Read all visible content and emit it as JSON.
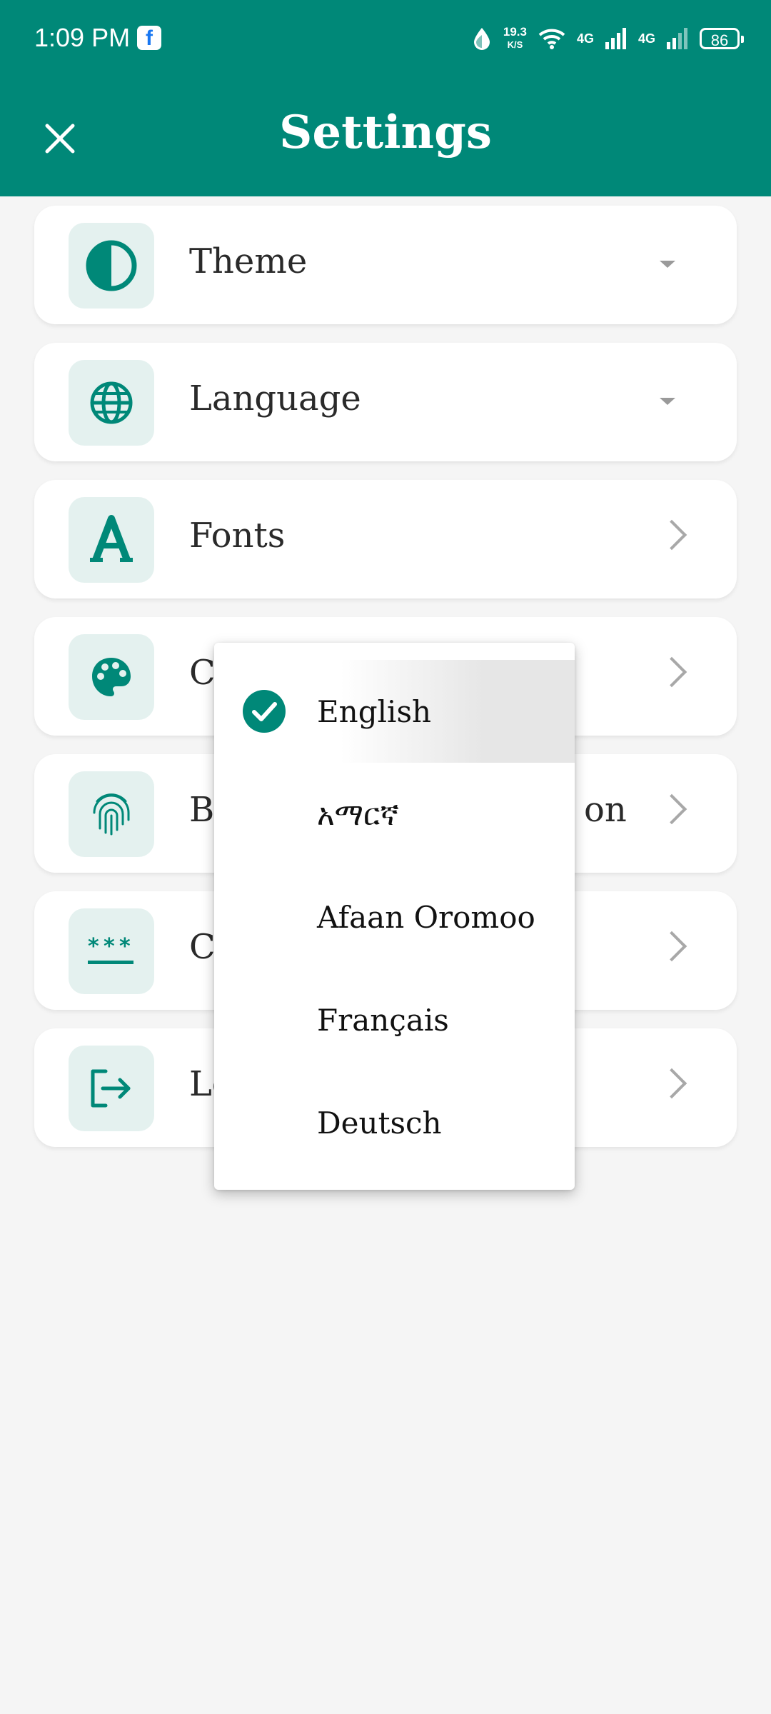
{
  "status_bar": {
    "time": "1:09 PM",
    "speed_value": "19.3",
    "speed_unit": "K/S",
    "network1": "4G",
    "network2": "4G",
    "battery": "86"
  },
  "header": {
    "title": "Settings",
    "close_icon": "close-icon"
  },
  "settings": [
    {
      "label": "Theme",
      "icon": "theme-icon",
      "trailing": "dropdown"
    },
    {
      "label": "Language",
      "icon": "globe-icon",
      "trailing": "dropdown"
    },
    {
      "label": "Fonts",
      "icon": "font-icon",
      "trailing": "chevron"
    },
    {
      "label": "Co",
      "icon": "palette-icon",
      "trailing": "chevron"
    },
    {
      "label": "Bi",
      "label_tail": "on",
      "icon": "fingerprint-icon",
      "trailing": "chevron"
    },
    {
      "label": "Cl",
      "icon": "password-icon",
      "trailing": "chevron"
    },
    {
      "label": "Lo",
      "icon": "logout-icon",
      "trailing": "chevron"
    }
  ],
  "language_menu": {
    "selected": "English",
    "options": [
      "English",
      "አማርኛ",
      "Afaan Oromoo",
      "Français",
      "Deutsch"
    ]
  },
  "colors": {
    "primary": "#008878",
    "icon_bg": "#e4f1ef",
    "background": "#f5f5f5"
  }
}
